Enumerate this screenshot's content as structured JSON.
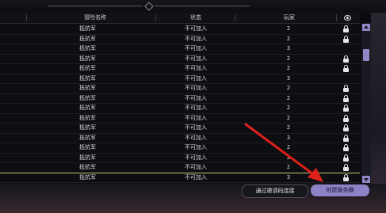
{
  "table": {
    "headers": {
      "name": "冒险名称",
      "status": "状态",
      "players": "玩家",
      "locked": "eye-icon"
    },
    "rows": [
      {
        "name": "抵抗军",
        "status": "不可加入",
        "players": "2",
        "locked": true
      },
      {
        "name": "抵抗军",
        "status": "不可加入",
        "players": "2",
        "locked": true
      },
      {
        "name": "抵抗军",
        "status": "不可加入",
        "players": "3",
        "locked": false
      },
      {
        "name": "抵抗军",
        "status": "不可加入",
        "players": "2",
        "locked": true
      },
      {
        "name": "抵抗军",
        "status": "不可加入",
        "players": "2",
        "locked": true
      },
      {
        "name": "抵抗军",
        "status": "不可加入",
        "players": "3",
        "locked": false
      },
      {
        "name": "抵抗军",
        "status": "不可加入",
        "players": "2",
        "locked": true
      },
      {
        "name": "抵抗军",
        "status": "不可加入",
        "players": "2",
        "locked": true
      },
      {
        "name": "抵抗军",
        "status": "不可加入",
        "players": "2",
        "locked": true
      },
      {
        "name": "抵抗军",
        "status": "不可加入",
        "players": "2",
        "locked": true
      },
      {
        "name": "抵抗军",
        "status": "不可加入",
        "players": "2",
        "locked": true
      },
      {
        "name": "抵抗军",
        "status": "不可加入",
        "players": "3",
        "locked": true
      },
      {
        "name": "抵抗军",
        "status": "不可加入",
        "players": "2",
        "locked": true
      },
      {
        "name": "抵抗军",
        "status": "不可加入",
        "players": "2",
        "locked": true
      },
      {
        "name": "抵抗军",
        "status": "不可加入",
        "players": "2",
        "locked": true
      },
      {
        "name": "抵抗军",
        "status": "不可加入",
        "players": "3",
        "locked": true
      }
    ]
  },
  "footer": {
    "invite_label": "通过邀请码连接",
    "create_label": "创建服务器"
  },
  "colors": {
    "accent": "#8c82c6",
    "selected_row": "#c7c86a",
    "arrow": "#e0201a"
  },
  "icons": {
    "lock": "lock-icon",
    "visibility": "eye-icon"
  }
}
